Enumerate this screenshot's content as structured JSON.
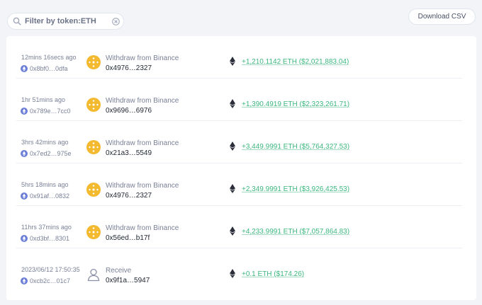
{
  "search": {
    "value": "Filter by token:ETH"
  },
  "toolbar": {
    "download_label": "Download CSV"
  },
  "colors": {
    "amount": "#3bb77e",
    "binance": "#f3ba2f",
    "eth_badge": "#6c7fd8"
  },
  "transactions": [
    {
      "time": "12mins 16secs ago",
      "account": "0x8bf0…0dfa",
      "source_icon": "binance-icon",
      "label": "Withdraw from Binance",
      "counterparty": "0x4976…2327",
      "amount": "+1,210.1142 ETH ($2,021,883.04)"
    },
    {
      "time": "1hr 51mins ago",
      "account": "0x789e…7cc0",
      "source_icon": "binance-icon",
      "label": "Withdraw from Binance",
      "counterparty": "0x9696…6976",
      "amount": "+1,390.4919 ETH ($2,323,261.71)"
    },
    {
      "time": "3hrs 42mins ago",
      "account": "0x7ed2…975e",
      "source_icon": "binance-icon",
      "label": "Withdraw from Binance",
      "counterparty": "0x21a3…5549",
      "amount": "+3,449.9991 ETH ($5,764,327.53)"
    },
    {
      "time": "5hrs 18mins ago",
      "account": "0x91af…0832",
      "source_icon": "binance-icon",
      "label": "Withdraw from Binance",
      "counterparty": "0x4976…2327",
      "amount": "+2,349.9991 ETH ($3,926,425.53)"
    },
    {
      "time": "11hrs 37mins ago",
      "account": "0xd3bf…8301",
      "source_icon": "binance-icon",
      "label": "Withdraw from Binance",
      "counterparty": "0x56ed…b17f",
      "amount": "+4,233.9991 ETH ($7,057,864.83)"
    },
    {
      "time": "2023/06/12 17:50:35",
      "account": "0xcb2c…01c7",
      "source_icon": "person-icon",
      "label": "Receive",
      "counterparty": "0x9f1a…5947",
      "amount": "+0.1 ETH ($174.26)"
    }
  ]
}
